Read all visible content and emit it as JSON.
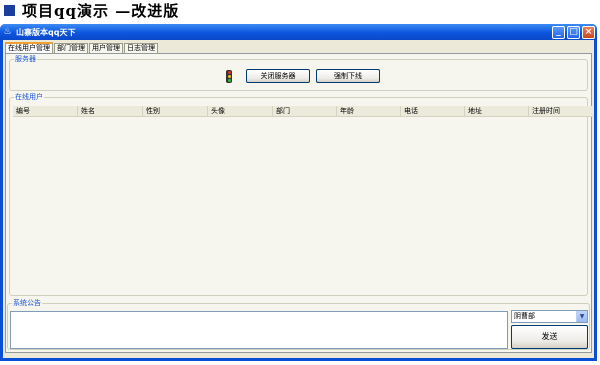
{
  "slide": {
    "heading": "项目qq演示 —改进版"
  },
  "window": {
    "title": "山寨版本qq天下",
    "controls": {
      "minimize": "_",
      "maximize": "□",
      "close": "×"
    }
  },
  "tabs": [
    {
      "label": "在线用户管理",
      "active": true
    },
    {
      "label": "部门管理",
      "active": false
    },
    {
      "label": "用户管理",
      "active": false
    },
    {
      "label": "日志管理",
      "active": false
    }
  ],
  "server_group": {
    "label": "服务器",
    "status_icon": "traffic-light-icon",
    "close_server_button": "关闭服务器",
    "force_offline_button": "强制下线"
  },
  "online_users_group": {
    "label": "在线用户",
    "columns": [
      "编号",
      "姓名",
      "性别",
      "头像",
      "部门",
      "年龄",
      "电话",
      "地址",
      "注册时间"
    ],
    "rows": []
  },
  "announcement_group": {
    "label": "系统公告",
    "message_value": "",
    "department_select_value": "阴曹部",
    "send_button": "发送"
  }
}
